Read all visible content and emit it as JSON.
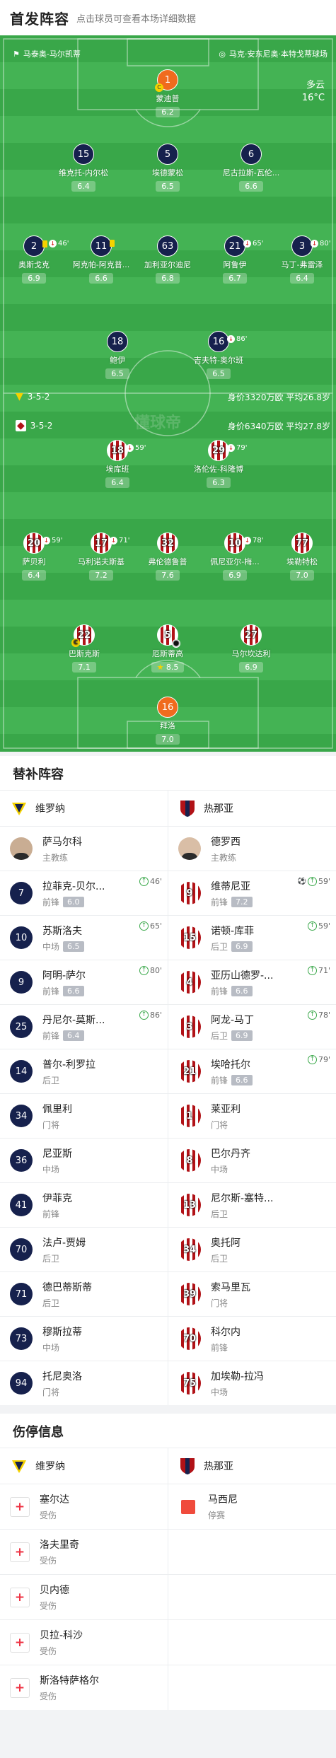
{
  "header": {
    "title": "首发阵容",
    "subtitle": "点击球员可查看本场详细数据"
  },
  "match": {
    "referee": "马泰奥-马尔凯蒂",
    "stadium": "马克·安东尼奥·本特戈蒂球场",
    "weather": "多云",
    "temperature": "16°C"
  },
  "home": {
    "name": "维罗纳",
    "formation": "3-5-2",
    "info": "身价3320万欧 平均26.8岁",
    "coach": "萨马尔科",
    "coach_role": "主教练"
  },
  "away": {
    "name": "热那亚",
    "formation": "3-5-2",
    "info": "身价6340万欧 平均27.8岁",
    "coach": "德罗西",
    "coach_role": "主教练"
  },
  "home_lineup": [
    {
      "no": "1",
      "name": "蒙迪普",
      "rating": "6.2"
    },
    {
      "no": "15",
      "name": "维克托-内尔松",
      "rating": "6.4"
    },
    {
      "no": "5",
      "name": "埃德蒙松",
      "rating": "6.5"
    },
    {
      "no": "6",
      "name": "尼古拉斯-瓦伦...",
      "rating": "6.6"
    },
    {
      "no": "2",
      "name": "奥斯戈克",
      "rating": "6.9",
      "event": "46'"
    },
    {
      "no": "11",
      "name": "阿克帕-阿克普...",
      "rating": "6.6"
    },
    {
      "no": "63",
      "name": "加利亚尔迪尼",
      "rating": "6.8"
    },
    {
      "no": "21",
      "name": "阿鲁伊",
      "rating": "6.7",
      "event": "65'"
    },
    {
      "no": "3",
      "name": "马丁-弗雷泽",
      "rating": "6.4",
      "event": "80'"
    },
    {
      "no": "18",
      "name": "鲍伊",
      "rating": "6.5"
    },
    {
      "no": "16",
      "name": "吉夫特-奥尔班",
      "rating": "6.5",
      "event": "86'"
    }
  ],
  "away_lineup": [
    {
      "no": "18",
      "name": "埃库班",
      "rating": "6.4",
      "event": "59'"
    },
    {
      "no": "29",
      "name": "洛伦佐-科隆博",
      "rating": "6.3",
      "event": "79'"
    },
    {
      "no": "20",
      "name": "萨贝利",
      "rating": "6.4",
      "event": "59'"
    },
    {
      "no": "17",
      "name": "马利诺夫斯基",
      "rating": "7.2",
      "event": "71'"
    },
    {
      "no": "32",
      "name": "弗伦德鲁普",
      "rating": "7.6"
    },
    {
      "no": "10",
      "name": "佩尼亚尔-梅...",
      "rating": "6.9",
      "event": "78'"
    },
    {
      "no": "77",
      "name": "埃勒特松",
      "rating": "7.0"
    },
    {
      "no": "22",
      "name": "巴斯克斯",
      "rating": "7.1"
    },
    {
      "no": "5",
      "name": "厄斯蒂高",
      "rating": "8.5"
    },
    {
      "no": "27",
      "name": "马尔坎达利",
      "rating": "6.9"
    },
    {
      "no": "16",
      "name": "拜洛",
      "rating": "7.0"
    }
  ],
  "subs": {
    "title": "替补阵容",
    "rows": [
      [
        {
          "no": "7",
          "name": "拉菲克-贝尔...",
          "pos": "前锋",
          "rating": "6.0",
          "event": "46'"
        },
        {
          "no": "9",
          "name": "维蒂尼亚",
          "pos": "前锋",
          "rating": "7.2",
          "event": "59'"
        }
      ],
      [
        {
          "no": "10",
          "name": "苏斯洛夫",
          "pos": "中场",
          "rating": "6.5",
          "event": "65'"
        },
        {
          "no": "15",
          "name": "诺顿-库菲",
          "pos": "后卫",
          "rating": "6.9",
          "event": "59'"
        }
      ],
      [
        {
          "no": "9",
          "name": "阿明-萨尔",
          "pos": "前锋",
          "rating": "6.6",
          "event": "80'"
        },
        {
          "no": "4",
          "name": "亚历山德罗-...",
          "pos": "前锋",
          "rating": "6.6",
          "event": "71'"
        }
      ],
      [
        {
          "no": "25",
          "name": "丹尼尔-莫斯...",
          "pos": "前锋",
          "rating": "6.4",
          "event": "86'"
        },
        {
          "no": "3",
          "name": "阿龙-马丁",
          "pos": "后卫",
          "rating": "6.9",
          "event": "78'"
        }
      ],
      [
        {
          "no": "14",
          "name": "普尔-利罗拉",
          "pos": "后卫"
        },
        {
          "no": "21",
          "name": "埃哈托尔",
          "pos": "前锋",
          "rating": "6.6",
          "event": "79'"
        }
      ],
      [
        {
          "no": "34",
          "name": "佩里利",
          "pos": "门将"
        },
        {
          "no": "1",
          "name": "莱亚利",
          "pos": "门将"
        }
      ],
      [
        {
          "no": "36",
          "name": "尼亚斯",
          "pos": "中场"
        },
        {
          "no": "8",
          "name": "巴尔丹齐",
          "pos": "中场"
        }
      ],
      [
        {
          "no": "41",
          "name": "伊菲克",
          "pos": "前锋"
        },
        {
          "no": "13",
          "name": "尼尔斯-塞特...",
          "pos": "后卫"
        }
      ],
      [
        {
          "no": "70",
          "name": "法卢-贾姆",
          "pos": "后卫"
        },
        {
          "no": "34",
          "name": "奥托阿",
          "pos": "后卫"
        }
      ],
      [
        {
          "no": "71",
          "name": "德巴蒂斯蒂",
          "pos": "后卫"
        },
        {
          "no": "39",
          "name": "索马里瓦",
          "pos": "门将"
        }
      ],
      [
        {
          "no": "73",
          "name": "穆斯拉蒂",
          "pos": "中场"
        },
        {
          "no": "70",
          "name": "科尔内",
          "pos": "前锋"
        }
      ],
      [
        {
          "no": "94",
          "name": "托尼奥洛",
          "pos": "门将"
        },
        {
          "no": "75",
          "name": "加埃勒-拉冯",
          "pos": "中场"
        }
      ]
    ]
  },
  "injuries": {
    "title": "伤停信息",
    "home": [
      {
        "name": "塞尔达",
        "status": "受伤"
      },
      {
        "name": "洛夫里奇",
        "status": "受伤"
      },
      {
        "name": "贝内德",
        "status": "受伤"
      },
      {
        "name": "贝拉-科沙",
        "status": "受伤"
      },
      {
        "name": "斯洛特萨格尔",
        "status": "受伤"
      }
    ],
    "away": [
      {
        "name": "马西尼",
        "status": "停赛"
      }
    ]
  },
  "watermark": "懂球帝",
  "colors": {
    "pitch": "#3ead4e",
    "home_shirt": "#16214d",
    "away_stripe": "#b11217",
    "keeper": "#f06b1e"
  }
}
